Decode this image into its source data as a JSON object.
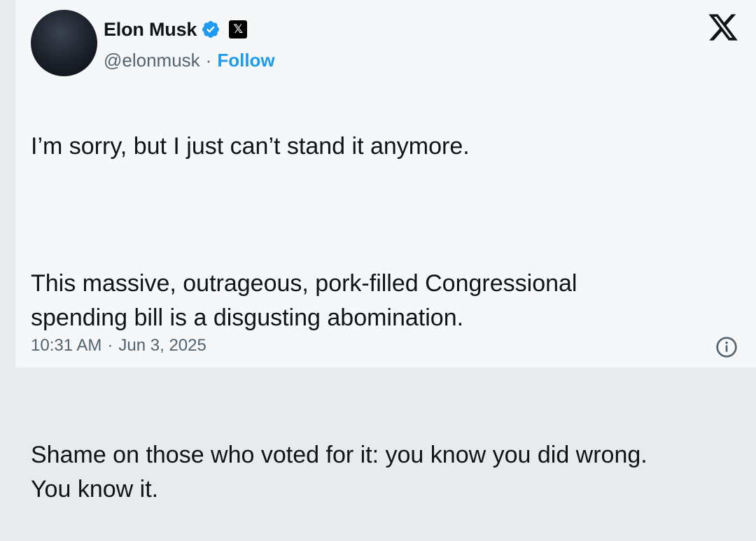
{
  "author": {
    "name": "Elon Musk",
    "handle": "@elonmusk",
    "separator": "·",
    "follow_label": "Follow",
    "verified_color": "#1d9bf0",
    "affiliation_badge_icon": "x-logo-badge-icon"
  },
  "tweet": {
    "paragraphs": [
      "I’m sorry, but I just can’t stand it anymore.",
      "This massive, outrageous, pork-filled Congressional spending bill is a disgusting abomination.",
      "Shame on those who voted for it: you know you did wrong. You know it."
    ]
  },
  "meta": {
    "time": "10:31 AM",
    "separator": "·",
    "date": "Jun 3, 2025"
  },
  "icons": {
    "platform": "x-logo-icon",
    "info": "info-icon"
  }
}
